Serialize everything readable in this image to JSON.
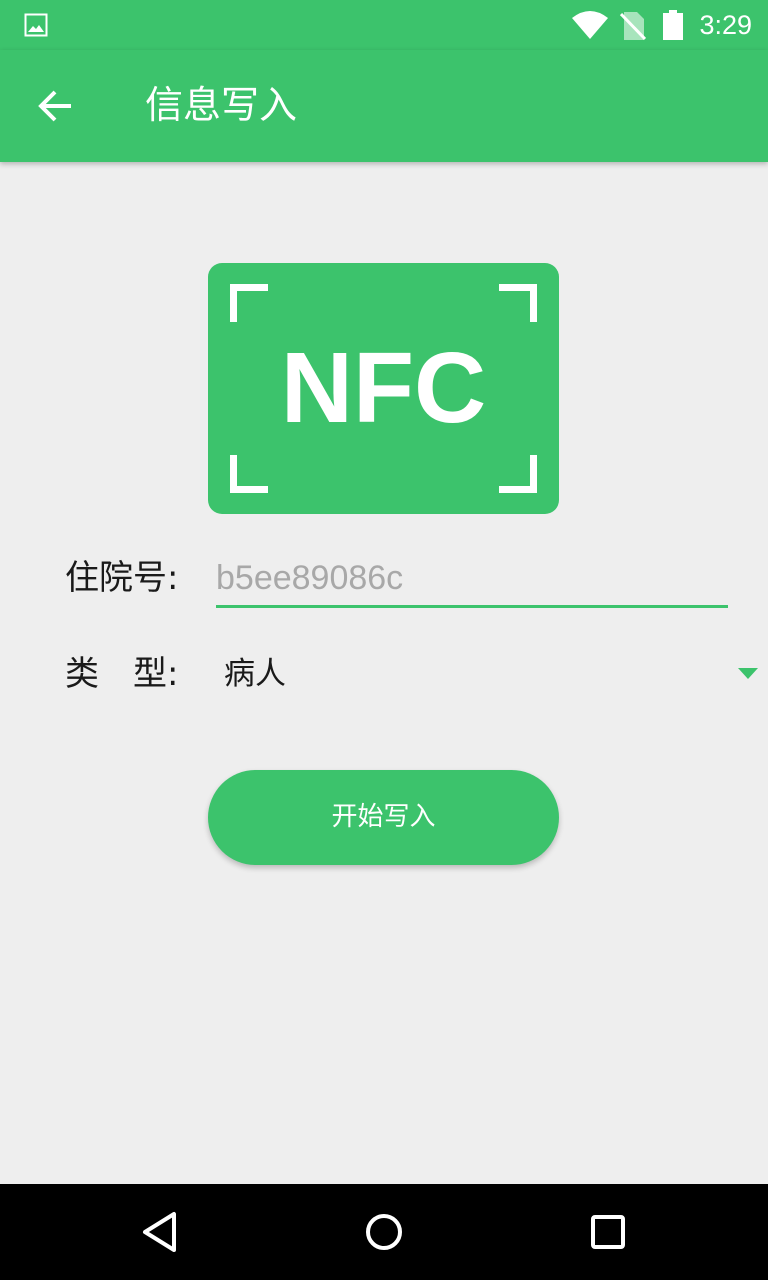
{
  "status_bar": {
    "time": "3:29",
    "icons": [
      "gallery-icon",
      "wifi-icon",
      "no-sim-icon",
      "battery-icon"
    ]
  },
  "app_bar": {
    "back_icon": "arrow-left-icon",
    "title": "信息写入"
  },
  "nfc_card": {
    "text": "NFC"
  },
  "form": {
    "admission_label": "住院号:",
    "admission_placeholder": "b5ee89086c",
    "admission_value": "",
    "type_label": "类　型:",
    "type_value": "病人"
  },
  "start_button": {
    "label": "开始写入"
  },
  "nav_bar": {
    "icons": [
      "back-triangle-icon",
      "home-circle-icon",
      "recents-square-icon"
    ]
  },
  "colors": {
    "accent": "#3cc36c",
    "background": "#eeeeee"
  }
}
